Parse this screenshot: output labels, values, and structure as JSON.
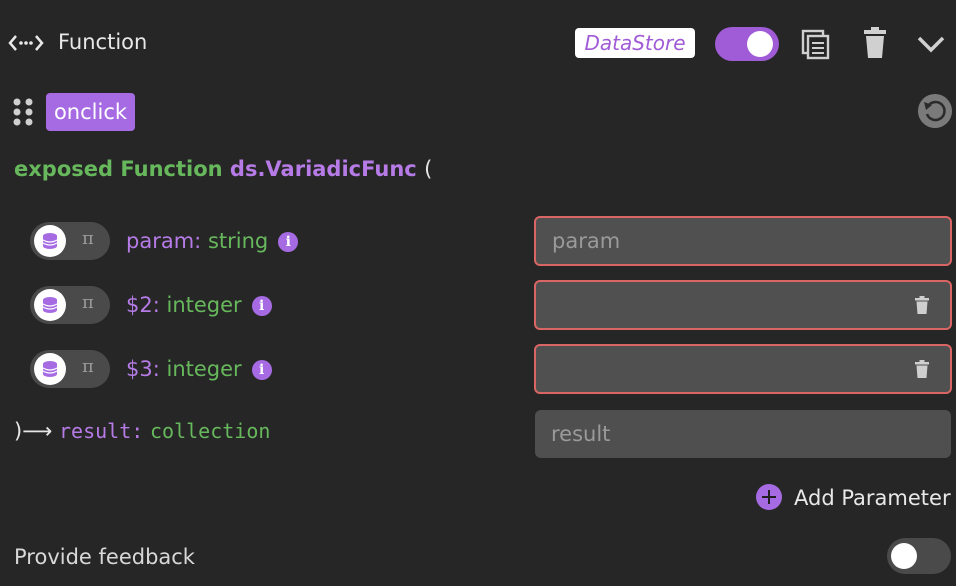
{
  "header": {
    "title": "Function",
    "source_badge": "DataStore",
    "enabled": true,
    "icons": [
      "function-icon",
      "copy-icon",
      "trash-icon",
      "chevron-down-icon"
    ]
  },
  "event": {
    "label": "onclick"
  },
  "declaration": {
    "keyword": "exposed Function",
    "name": "ds.VariadicFunc",
    "open_paren": "("
  },
  "params": [
    {
      "name": "param",
      "colon": ":",
      "type": "string",
      "value": "",
      "placeholder": "param",
      "deletable": false
    },
    {
      "name": "$2",
      "colon": ":",
      "type": "integer",
      "value": "",
      "placeholder": "",
      "deletable": true
    },
    {
      "name": "$3",
      "colon": ":",
      "type": "integer",
      "value": "",
      "placeholder": "",
      "deletable": true
    }
  ],
  "param_toggle_alt_symbol": "π",
  "info_symbol": "i",
  "result": {
    "prefix": ")⟶",
    "name": "result",
    "colon": ":",
    "type": "collection",
    "placeholder": "result"
  },
  "add_parameter_label": "Add Parameter",
  "feedback": {
    "label": "Provide feedback",
    "enabled": false
  },
  "colors": {
    "accent": "#a66be3",
    "keyword": "#67b85c",
    "error_border": "#d96565",
    "background": "#262626"
  }
}
